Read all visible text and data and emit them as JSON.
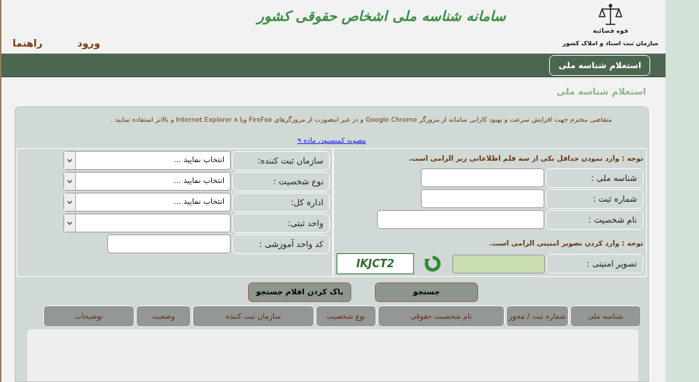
{
  "header": {
    "logo_caption": "قوه قضائیه",
    "organization": "سازمان ثبت اسناد و املاک کشور",
    "title": "سامانه شناسه ملی اشخاص حقوقی کشور",
    "links": [
      "ورود",
      "راهنما"
    ]
  },
  "nav_tabs": [
    {
      "label": "استعلام شناسه ملی",
      "selected": true
    }
  ],
  "page_heading": "استعلام شناسه ملی",
  "notice": {
    "text": "متقاضی محترم جهت افزایش سرعت و بهبود کارایی سامانه از مرورگر Google Chrome و در غیر اینصورت از مرورگرهای FireFox ویا ۸ Internet Explorer و بالاتر استفاده نمایید .",
    "link": "مصوبه کمیسیون ماده ۹"
  },
  "right_form": {
    "note": "توجه : وارد نمودن حداقل یکی از سه قلم اطلاعاتی زیر الزامی است.",
    "fields": [
      {
        "label": "شناسه ملی :",
        "wide": false
      },
      {
        "label": "شماره ثبت :",
        "wide": false
      },
      {
        "label": "نام شخصیت :",
        "wide": true
      }
    ],
    "captcha_note": "توجه : وارد کردن تصویر امنیتی الزامی است.",
    "captcha": {
      "label": "تصویر امنیتی :",
      "image_text": "IKJCT2"
    }
  },
  "left_form": {
    "fields": [
      {
        "kind": "select",
        "label": "سازمان ثبت کننده:",
        "value": "انتخاب نمایید ..."
      },
      {
        "kind": "select",
        "label": "نوع شخصیت :",
        "value": "انتخاب نمایید ..."
      },
      {
        "kind": "select",
        "label": "اداره کل:",
        "value": "انتخاب نمایید ..."
      },
      {
        "kind": "select",
        "label": "واحد ثبتی:"
      },
      {
        "kind": "text",
        "label": "کد واحد آموزشی :"
      }
    ]
  },
  "buttons": [
    "جستجو",
    "پاک کردن اقلام جستجو"
  ],
  "table": {
    "columns": [
      "شناسه ملی",
      "شماره ثبت / مجوز",
      "نام شخصیت حقوقی",
      "نوع شخصیت",
      "سازمان ثبت کننده",
      "وضعیت",
      "توضیحات"
    ]
  }
}
